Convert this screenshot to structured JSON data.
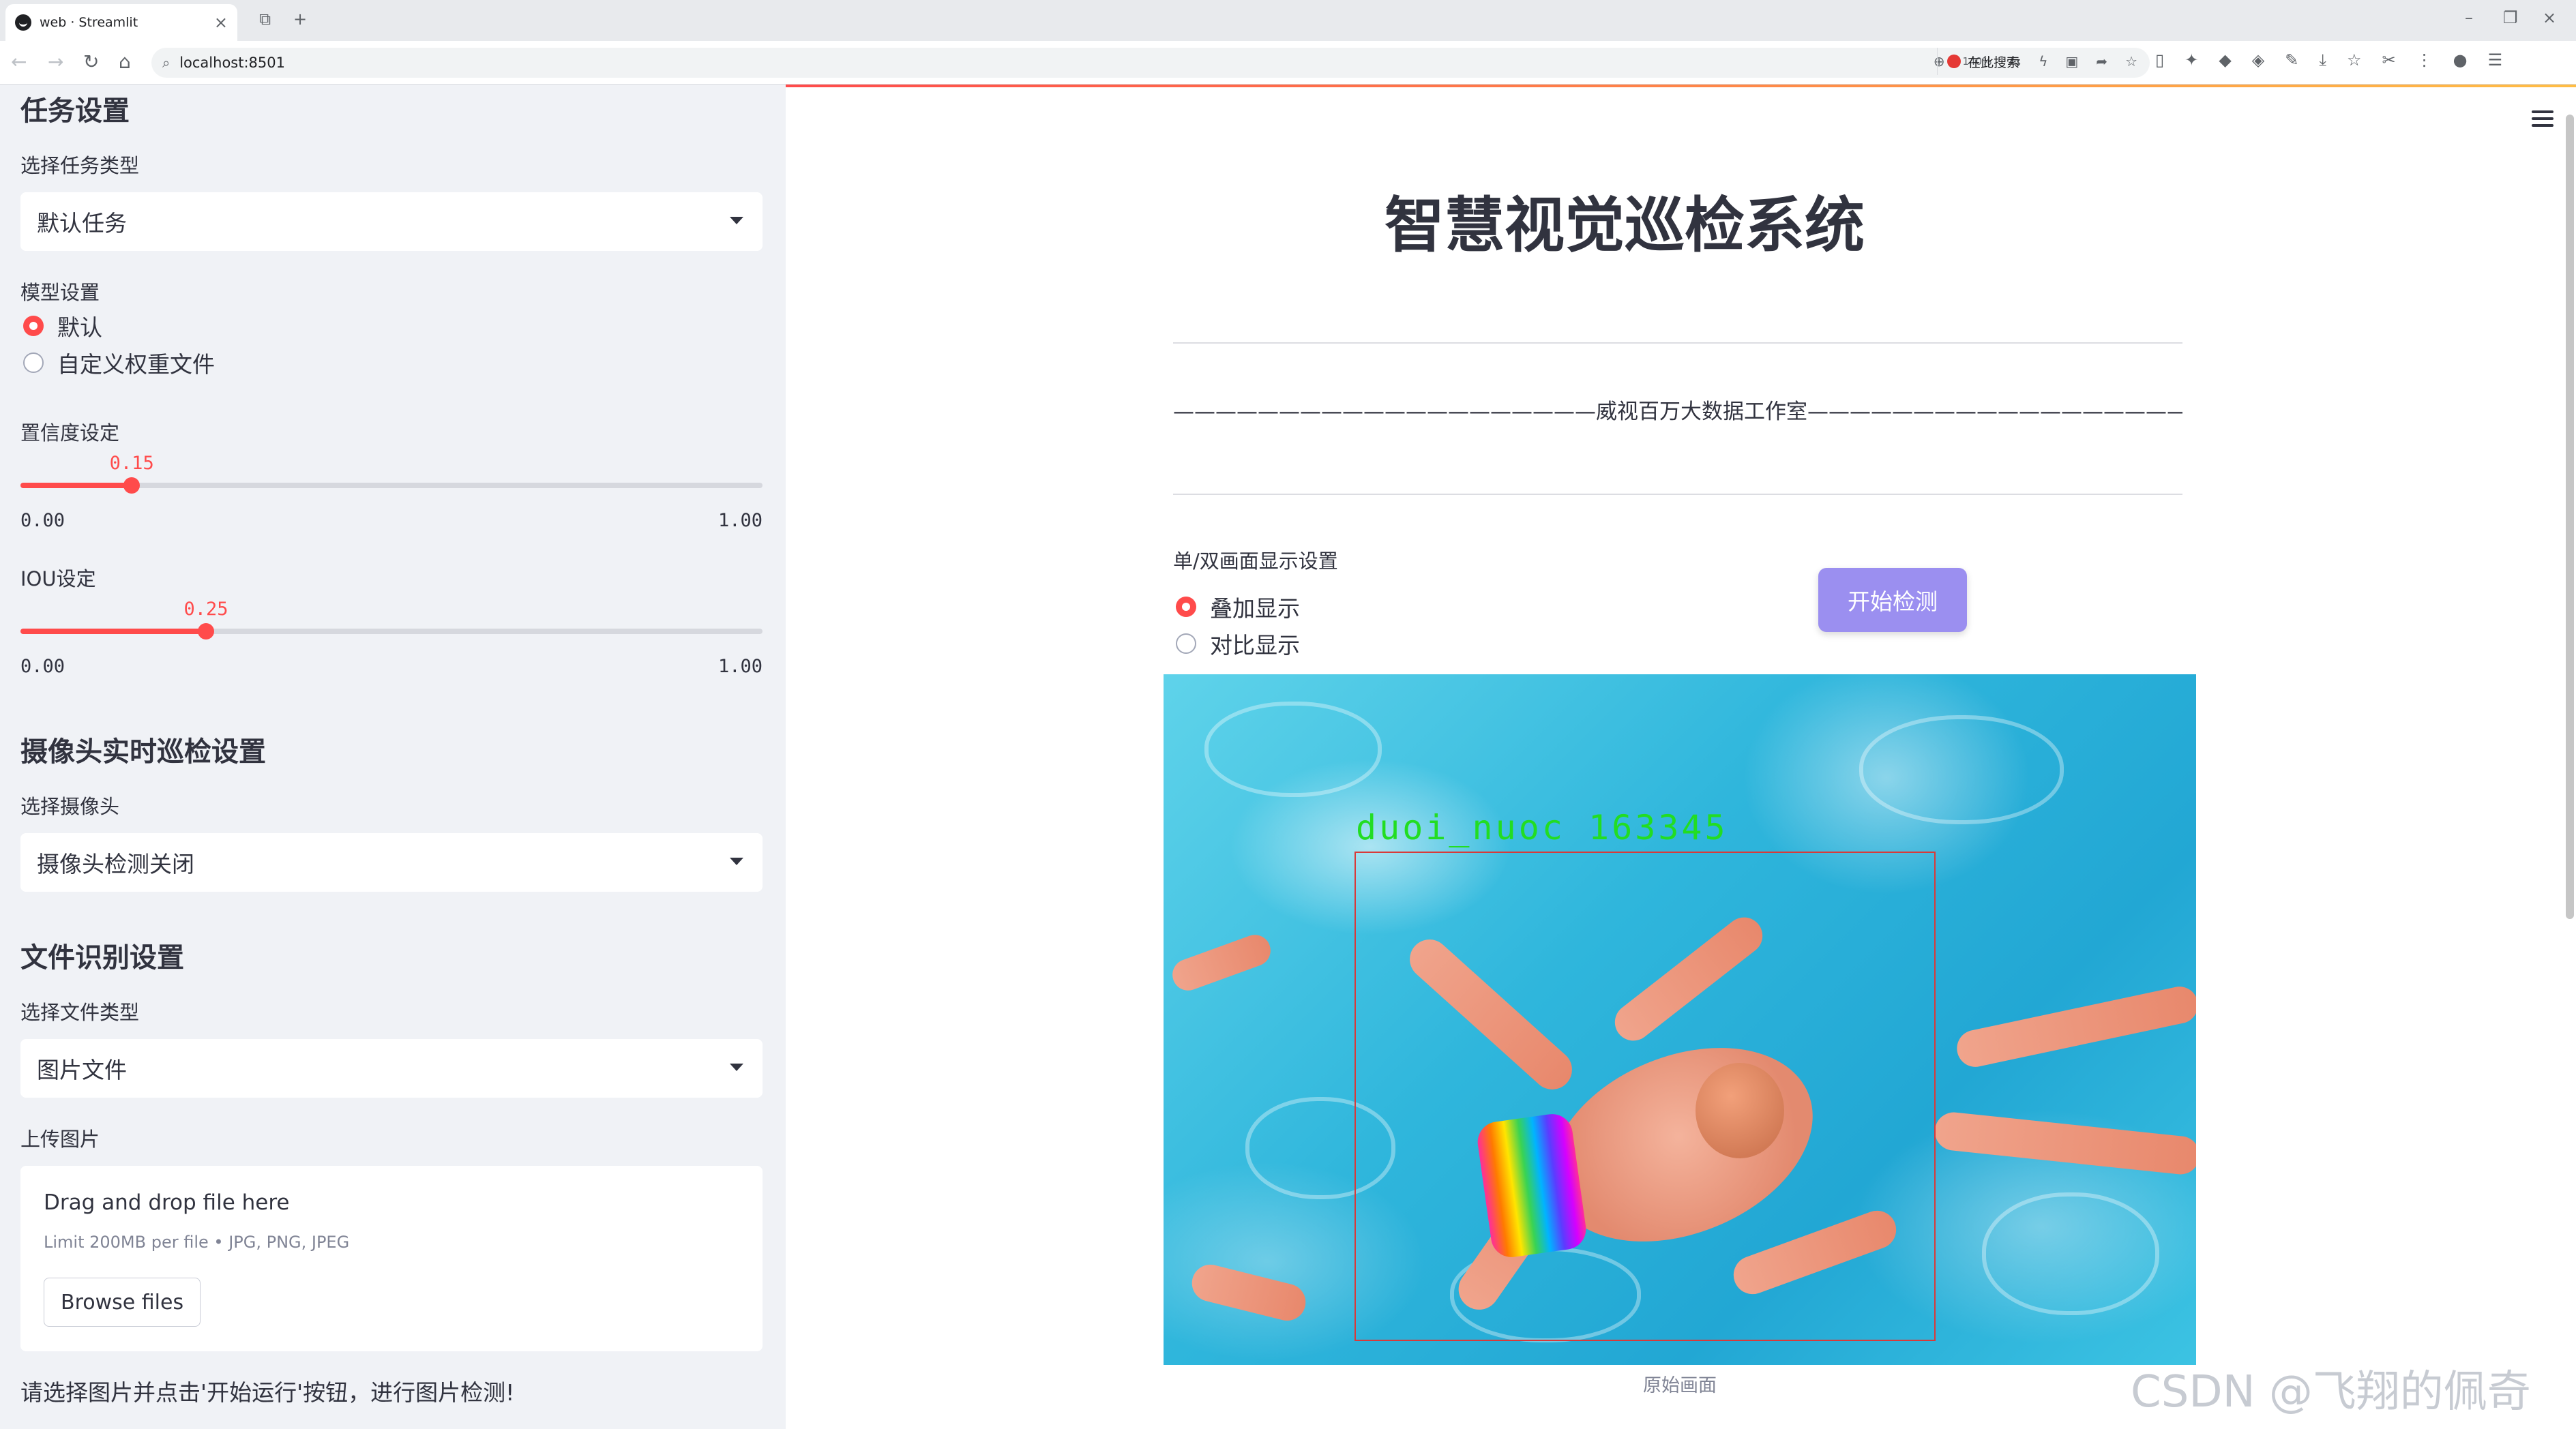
{
  "browser": {
    "tab_title": "web · Streamlit",
    "url": "localhost:8501",
    "zoom": "140%",
    "search_placeholder": "在此搜索"
  },
  "sidebar": {
    "task_header": "任务设置",
    "task_type_label": "选择任务类型",
    "task_type_value": "默认任务",
    "model_label": "模型设置",
    "model_options": [
      "默认",
      "自定义权重文件"
    ],
    "model_selected": 0,
    "conf_label": "置信度设定",
    "conf_value": "0.15",
    "conf_fraction": 0.15,
    "conf_min": "0.00",
    "conf_max": "1.00",
    "iou_label": "IOU设定",
    "iou_value": "0.25",
    "iou_fraction": 0.25,
    "iou_min": "0.00",
    "iou_max": "1.00",
    "camera_header": "摄像头实时巡检设置",
    "camera_label": "选择摄像头",
    "camera_value": "摄像头检测关闭",
    "file_header": "文件识别设置",
    "file_type_label": "选择文件类型",
    "file_type_value": "图片文件",
    "upload_label": "上传图片",
    "upload_title": "Drag and drop file here",
    "upload_limit": "Limit 200MB per file • JPG, PNG, JPEG",
    "browse_label": "Browse files",
    "footer_note": "请选择图片并点击'开始运行'按钮，进行图片检测!"
  },
  "main": {
    "title": "智慧视觉巡检系统",
    "banner": "————————————————————威视百万大数据工作室—————————————————————",
    "display_label": "单/双画面显示设置",
    "display_options": [
      "叠加显示",
      "对比显示"
    ],
    "display_selected": 0,
    "start_button": "开始检测",
    "detection_label": "duoi_nuoc 163345",
    "caption": "原始画面"
  },
  "watermark": "CSDN @飞翔的佩奇",
  "colors": {
    "accent": "#ff4b4b",
    "button": "#9b8ff0",
    "detection_box": "#d83a3a",
    "detection_text": "#22dd22"
  }
}
